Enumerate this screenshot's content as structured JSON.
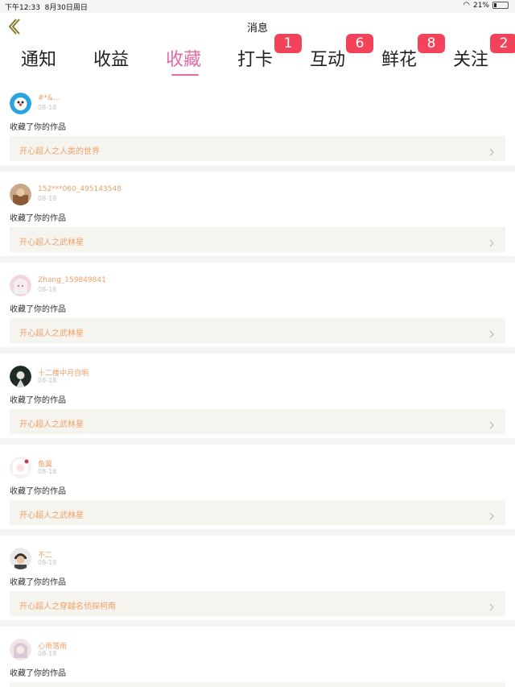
{
  "status_bar": {
    "time": "下午12:33",
    "date": "8月30日周日",
    "battery": "21%",
    "battery_level": 0.21
  },
  "nav": {
    "title": "消息"
  },
  "tabs": [
    {
      "label": "通知"
    },
    {
      "label": "收益"
    },
    {
      "label": "收藏",
      "active": true
    },
    {
      "label": "打卡",
      "badge": "1"
    },
    {
      "label": "互动",
      "badge": "6"
    },
    {
      "label": "鲜花",
      "badge": "8"
    },
    {
      "label": "关注",
      "badge": "2"
    }
  ],
  "colors": {
    "accent": "#e46aa2",
    "badge": "#f2435b",
    "username": "#e9a06a",
    "work_title": "#eea069",
    "work_bg": "#f6f4ee"
  },
  "items": [
    {
      "username": "#*&...",
      "date": "08-18",
      "action": "收藏了你的作品",
      "work": "开心超人之人类的世界"
    },
    {
      "username": "152***060_495143548",
      "date": "08-18",
      "action": "收藏了你的作品",
      "work": "开心超人之武林星"
    },
    {
      "username": "Zhang_159849841",
      "date": "08-18",
      "action": "收藏了你的作品",
      "work": "开心超人之武林星"
    },
    {
      "username": "十二楼中月自明",
      "date": "08-18",
      "action": "收藏了你的作品",
      "work": "开心超人之武林星"
    },
    {
      "username": "鱼翼",
      "date": "08-18",
      "action": "收藏了你的作品",
      "work": "开心超人之武林星"
    },
    {
      "username": "不二",
      "date": "08-18",
      "action": "收藏了你的作品",
      "work": "开心超人之穿越名侦探柯南"
    },
    {
      "username": "心雨落雨",
      "date": "08-18",
      "action": "收藏了你的作品",
      "work": ""
    }
  ]
}
